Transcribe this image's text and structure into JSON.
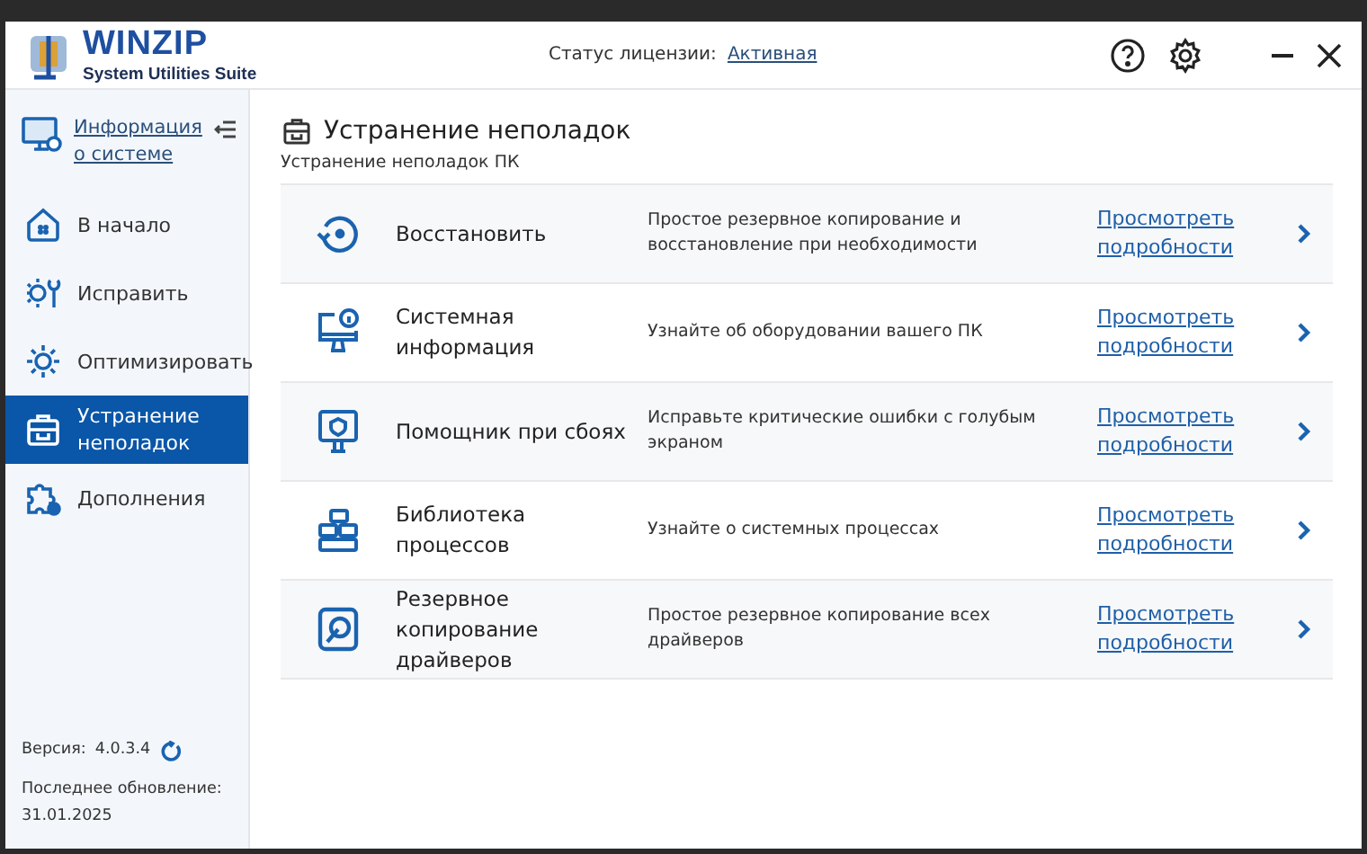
{
  "header": {
    "logo_title": "WINZIP",
    "logo_subtitle": "System Utilities Suite",
    "license_label": "Статус лицензии:",
    "license_status": "Активная"
  },
  "sidebar": {
    "system_info_link": "Информация о системе",
    "items": [
      {
        "kind": "home",
        "label": "В начало",
        "selected": false
      },
      {
        "kind": "repair",
        "label": "Исправить",
        "selected": false
      },
      {
        "kind": "optimize",
        "label": "Оптимизировать",
        "selected": false
      },
      {
        "kind": "toolbox",
        "label": "Устранение неполадок",
        "selected": true
      },
      {
        "kind": "puzzle",
        "label": "Дополнения",
        "selected": false
      }
    ],
    "version_label": "Версия:",
    "version": "4.0.3.4",
    "updated_label": "Последнее обновление:",
    "updated_date": "31.01.2025"
  },
  "page": {
    "title": "Устранение неполадок",
    "subtitle": "Устранение неполадок ПК",
    "tools": [
      {
        "kind": "restore",
        "name": "Восстановить",
        "description": "Простое резервное копирование и восстановление при необходимости",
        "link": "Просмотреть подробности"
      },
      {
        "kind": "sysinfo",
        "name": "Системная информация",
        "description": "Узнайте об оборудовании вашего ПК",
        "link": "Просмотреть подробности"
      },
      {
        "kind": "crash",
        "name": "Помощник при сбоях",
        "description": "Исправьте критические ошибки с голубым экраном",
        "link": "Просмотреть подробности"
      },
      {
        "kind": "processes",
        "name": "Библиотека процессов",
        "description": "Узнайте о системных процессах",
        "link": "Просмотреть подробности"
      },
      {
        "kind": "drivers",
        "name": "Резервное копирование драйверов",
        "description": "Простое резервное копирование всех драйверов",
        "link": "Просмотреть подробности"
      }
    ]
  }
}
